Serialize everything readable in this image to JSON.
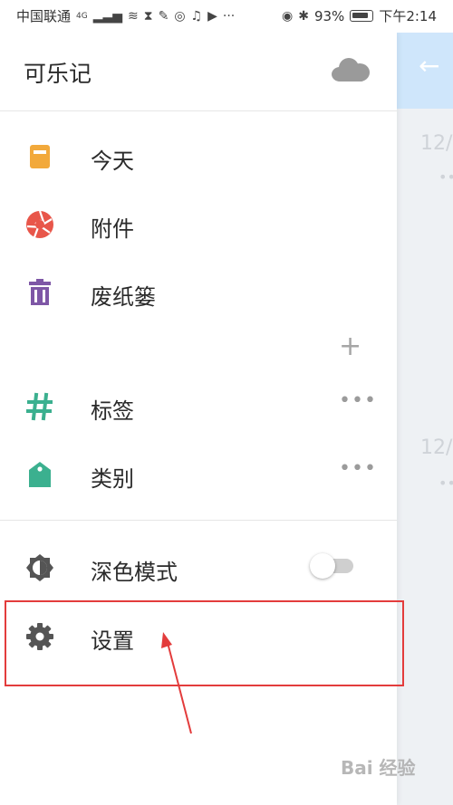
{
  "status_bar": {
    "carrier": "中国联通",
    "network": "4G",
    "battery": "93%",
    "time": "下午2:14"
  },
  "drawer": {
    "title": "可乐记",
    "items": [
      {
        "label": "今天",
        "icon": "calendar-today-icon",
        "color": "#f2a93b"
      },
      {
        "label": "附件",
        "icon": "aperture-icon",
        "color": "#e8564a"
      },
      {
        "label": "废纸篓",
        "icon": "trash-icon",
        "color": "#7e57a6"
      },
      {
        "label": "标签",
        "icon": "hashtag-icon",
        "color": "#3bb08f"
      },
      {
        "label": "类别",
        "icon": "tag-icon",
        "color": "#3bb08f"
      },
      {
        "label": "深色模式",
        "icon": "brightness-icon",
        "color": "#555555"
      },
      {
        "label": "设置",
        "icon": "gear-icon",
        "color": "#555555"
      }
    ],
    "more_glyph": "•••",
    "add_glyph": "+"
  },
  "background": {
    "dates": [
      "12/",
      "12/"
    ]
  },
  "annotation": {
    "highlight_color": "#e33c3c"
  },
  "watermark": {
    "text": "Bai 经验"
  }
}
